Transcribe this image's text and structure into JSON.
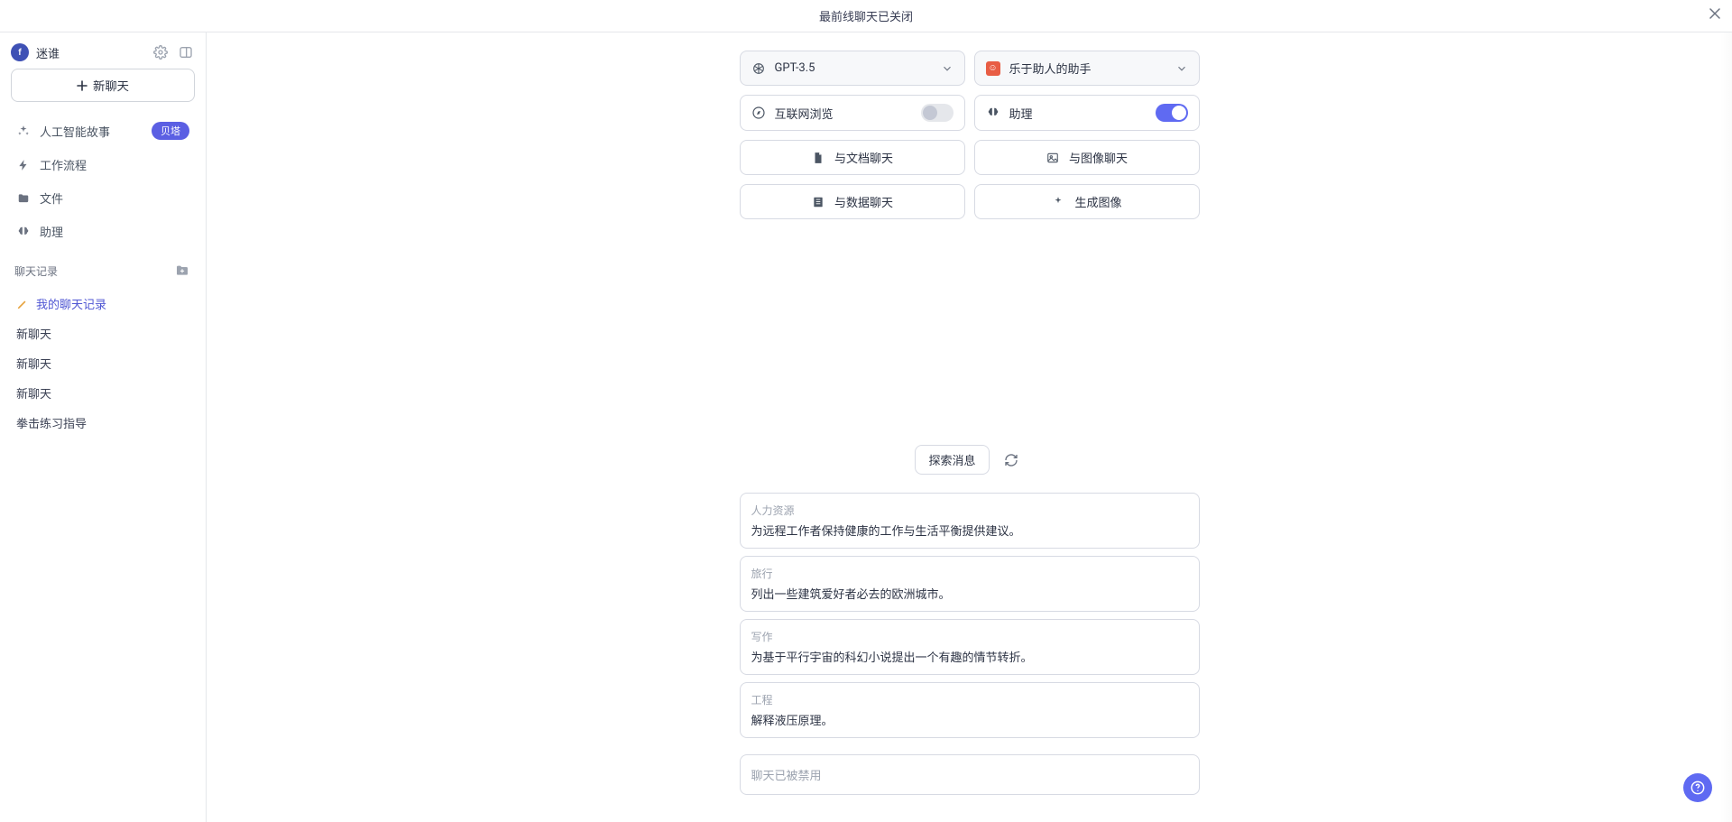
{
  "banner": {
    "text": "最前线聊天已关闭"
  },
  "user": {
    "avatar_initial": "f",
    "name": "迷谁"
  },
  "sidebar": {
    "new_chat": "新聊天",
    "items": [
      {
        "icon": "sparkle",
        "label": "人工智能故事",
        "badge": "贝塔"
      },
      {
        "icon": "bolt",
        "label": "工作流程"
      },
      {
        "icon": "folder",
        "label": "文件"
      },
      {
        "icon": "brain",
        "label": "助理"
      }
    ],
    "history_header": "聊天记录",
    "history": [
      {
        "label": "我的聊天记录",
        "active": true,
        "icon": "pencil"
      },
      {
        "label": "新聊天"
      },
      {
        "label": "新聊天"
      },
      {
        "label": "新聊天"
      },
      {
        "label": "拳击练习指导"
      }
    ]
  },
  "controls": {
    "model": "GPT-3.5",
    "persona": "乐于助人的助手",
    "browse_label": "互联网浏览",
    "browse_on": false,
    "assistant_label": "助理",
    "assistant_on": true,
    "chat_doc": "与文档聊天",
    "chat_image": "与图像聊天",
    "chat_data": "与数据聊天",
    "gen_image": "生成图像"
  },
  "explore": {
    "label": "探索消息"
  },
  "prompts": [
    {
      "category": "人力资源",
      "text": "为远程工作者保持健康的工作与生活平衡提供建议。"
    },
    {
      "category": "旅行",
      "text": "列出一些建筑爱好者必去的欧洲城市。"
    },
    {
      "category": "写作",
      "text": "为基于平行宇宙的科幻小说提出一个有趣的情节转折。"
    },
    {
      "category": "工程",
      "text": "解释液压原理。"
    }
  ],
  "chat_input": {
    "placeholder": "聊天已被禁用"
  }
}
